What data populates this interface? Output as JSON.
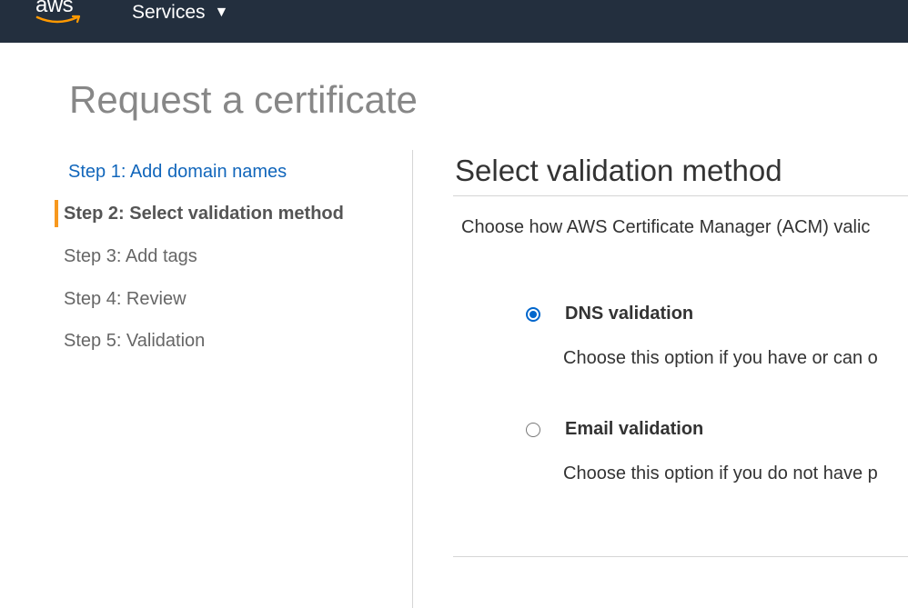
{
  "header": {
    "logo_text": "aws",
    "logo_icon": "aws-smile-logo",
    "services_label": "Services",
    "services_icon": "caret-down-icon",
    "background_color": "#232f3e",
    "accent_color": "#ff9900"
  },
  "page": {
    "title": "Request a certificate"
  },
  "steps": [
    {
      "label": "Step 1: Add domain names",
      "state": "link"
    },
    {
      "label": "Step 2: Select validation method",
      "state": "active"
    },
    {
      "label": "Step 3: Add tags",
      "state": "inactive"
    },
    {
      "label": "Step 4: Review",
      "state": "inactive"
    },
    {
      "label": "Step 5: Validation",
      "state": "inactive"
    }
  ],
  "step_marker_color": "#f7981e",
  "main": {
    "section_title": "Select validation method",
    "description": "Choose how AWS Certificate Manager (ACM) valic",
    "options": [
      {
        "label": "DNS validation",
        "description": "Choose this option if you have or can o",
        "selected": true
      },
      {
        "label": "Email validation",
        "description": "Choose this option if you do not have p",
        "selected": false
      }
    ]
  }
}
